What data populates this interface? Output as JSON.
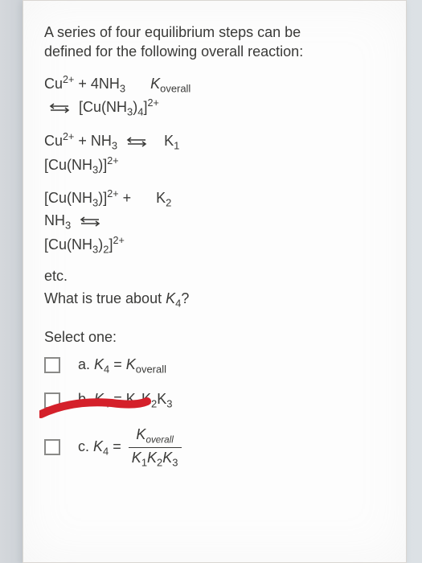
{
  "intro_line1": "A series of four equilibrium steps can be",
  "intro_line2": "defined for the following overall reaction:",
  "overall": {
    "lhs": "Cu²⁺ + 4NH₃",
    "klabel_prefix": "K",
    "klabel_sub": "overall",
    "rhs": "[Cu(NH₃)₄]²⁺"
  },
  "step1": {
    "lhs": "Cu²⁺ + NH₃",
    "kprefix": "K",
    "ksub": "1",
    "rhs": "[Cu(NH₃)]²⁺"
  },
  "step2": {
    "lhs1": "[Cu(NH₃)]²⁺ +",
    "kprefix": "K",
    "ksub": "2",
    "lhs2": "NH₃",
    "rhs": "[Cu(NH₃)₂]²⁺"
  },
  "etc": "etc.",
  "question_pre": "What is true about ",
  "question_k": "K",
  "question_sub": "4",
  "question_post": "?",
  "select": "Select one:",
  "options": {
    "a": {
      "letter": "a.",
      "lhs_k": "K",
      "lhs_sub": "4",
      "eq": " = ",
      "rhs_k": "K",
      "rhs_sub": "overall"
    },
    "b": {
      "letter": "b.",
      "lhs_k": "K",
      "lhs_sub": "4",
      "eq": " = ",
      "rhs": "K₁K₂K₃"
    },
    "c": {
      "letter": "c.",
      "lhs_k": "K",
      "lhs_sub": "4",
      "eq": " = ",
      "num_k": "K",
      "num_sub": "overall",
      "den": "K₁K₂K₃"
    }
  }
}
